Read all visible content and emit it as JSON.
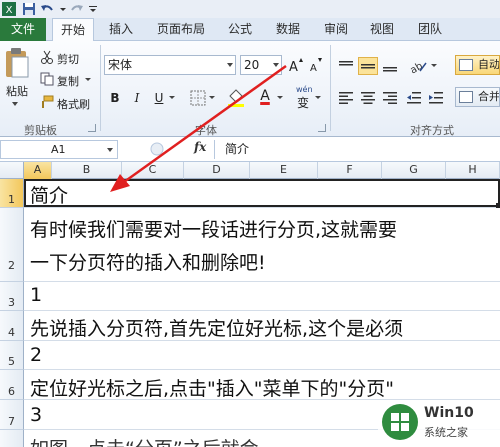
{
  "tabs": {
    "file": "文件",
    "items": [
      "开始",
      "插入",
      "页面布局",
      "公式",
      "数据",
      "审阅",
      "视图",
      "团队"
    ]
  },
  "clipboard": {
    "paste": "粘贴",
    "cut": "剪切",
    "copy": "复制",
    "format_painter": "格式刷",
    "group": "剪贴板"
  },
  "font": {
    "name": "宋体",
    "size": "20",
    "bold": "B",
    "italic": "I",
    "underline": "U",
    "color_letter": "A",
    "wen": "wén",
    "wen_char": "变",
    "group": "字体"
  },
  "alignment": {
    "wrap_text": "自动换行",
    "merge": "合并后居中",
    "group": "对齐方式"
  },
  "formula_bar": {
    "cell_ref": "A1",
    "fx": "fx",
    "value": "简介"
  },
  "columns": [
    "A",
    "B",
    "C",
    "D",
    "E",
    "F",
    "G",
    "H"
  ],
  "rows": [
    {
      "num": "1",
      "lines": [
        "简介"
      ]
    },
    {
      "num": "2",
      "lines": [
        "有时候我们需要对一段话进行分页,这就需要",
        "一下分页符的插入和删除吧!"
      ]
    },
    {
      "num": "3",
      "lines": [
        "1"
      ]
    },
    {
      "num": "4",
      "lines": [
        "先说插入分页符,首先定位好光标,这个是必须"
      ]
    },
    {
      "num": "5",
      "lines": [
        "2"
      ]
    },
    {
      "num": "6",
      "lines": [
        "定位好光标之后,点击\"插入\"菜单下的\"分页\""
      ]
    },
    {
      "num": "7",
      "lines": [
        "3"
      ]
    }
  ],
  "partial_row": "如图，点击“分页”之后就会",
  "annotation": {
    "color": "#e02020"
  },
  "watermark": {
    "title": "Win10",
    "subtitle": "系统之家"
  },
  "colors": {
    "file_tab": "#2a7a3c",
    "selection": "#f3c75b"
  }
}
